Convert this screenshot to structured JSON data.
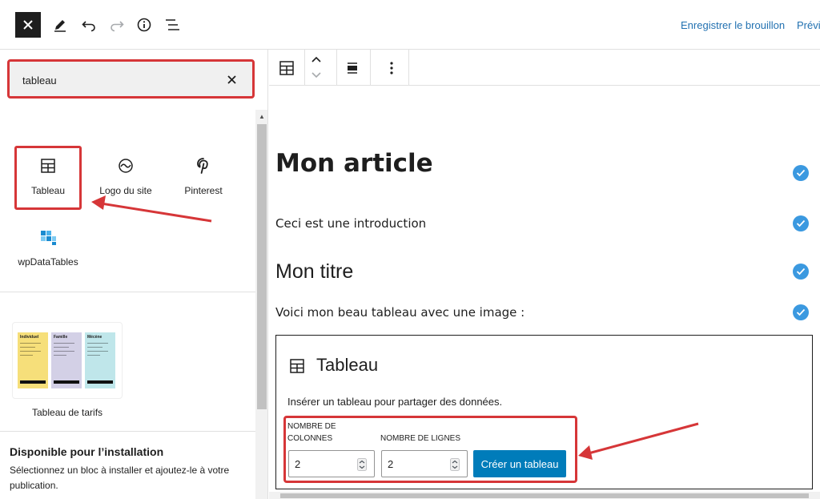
{
  "toolbar": {
    "close_icon": "close-icon",
    "draft_label": "Enregistrer le brouillon",
    "preview_label": "Prévis"
  },
  "inserter": {
    "search_value": "tableau",
    "results": [
      {
        "label": "Tableau",
        "icon": "table-icon",
        "highlighted": true
      },
      {
        "label": "Logo du site",
        "icon": "site-logo-icon",
        "highlighted": false
      },
      {
        "label": "Pinterest",
        "icon": "pinterest-icon",
        "highlighted": false
      },
      {
        "label": "wpDataTables",
        "icon": "wpdatatables-icon",
        "highlighted": false
      }
    ],
    "pattern": {
      "label": "Tableau de tarifs",
      "columns": [
        {
          "title": "Individuel",
          "color": "#f6df7a"
        },
        {
          "title": "Famille",
          "color": "#d3d0e6"
        },
        {
          "title": "Mécène",
          "color": "#bfe6ea"
        }
      ]
    },
    "available": {
      "title": "Disponible pour l’installation",
      "description": "Sélectionnez un bloc à installer et ajoutez-le à votre publication."
    }
  },
  "editor": {
    "heading1": "Mon article",
    "intro": "Ceci est une introduction",
    "heading2": "Mon titre",
    "paragraph": "Voici mon beau tableau avec une image :",
    "table_placeholder": {
      "title": "Tableau",
      "description": "Insérer un tableau pour partager des données.",
      "columns_label_line1": "Nombre de",
      "columns_label_line2": "colonnes",
      "rows_label": "Nombre de lignes",
      "columns_value": "2",
      "rows_value": "2",
      "create_label": "Créer un tableau"
    }
  },
  "colors": {
    "accent": "#007cba",
    "link": "#2271b1",
    "highlight": "#d63638",
    "check": "#3b99e0"
  }
}
